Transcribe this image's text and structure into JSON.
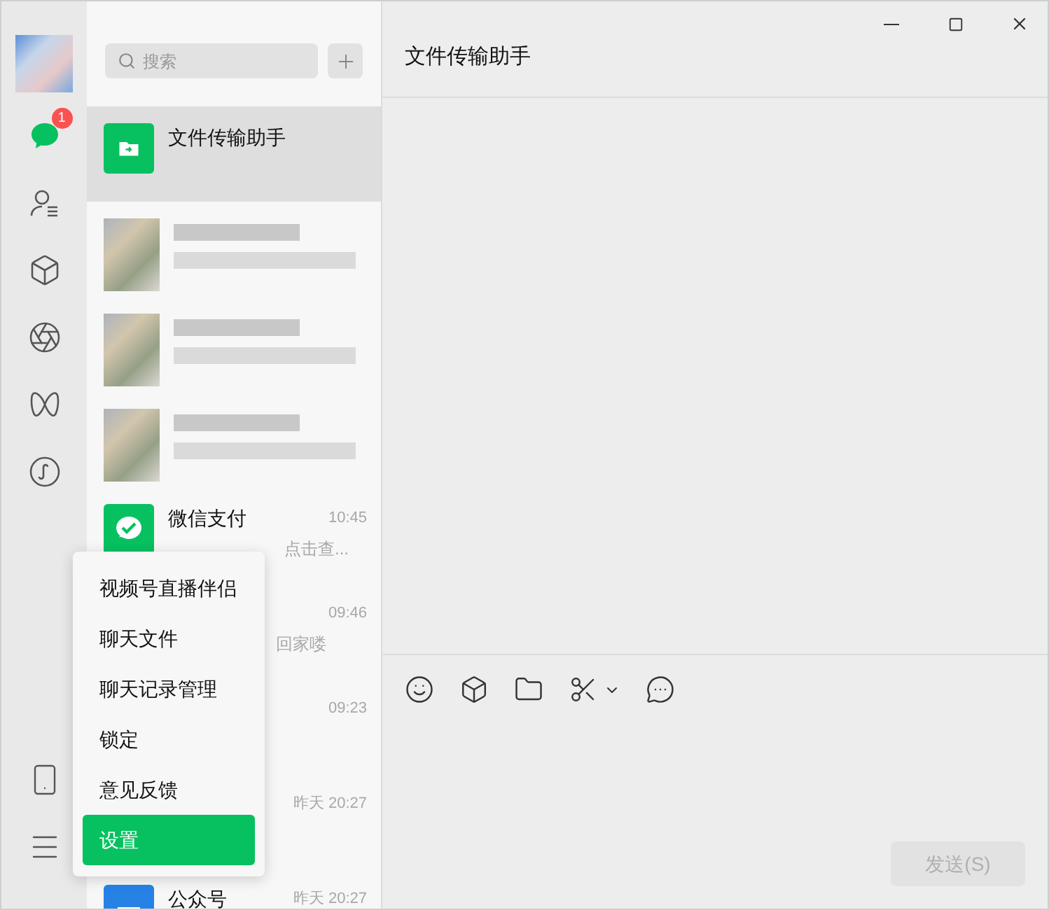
{
  "window": {
    "title": "文件传输助手"
  },
  "sidebar": {
    "items": [
      {
        "kind": "chat",
        "selected": true,
        "badge": "1"
      },
      {
        "kind": "contacts",
        "selected": false
      },
      {
        "kind": "cube",
        "selected": false
      },
      {
        "kind": "shutter",
        "selected": false
      },
      {
        "kind": "channels",
        "selected": false
      },
      {
        "kind": "miniprogram",
        "selected": false
      }
    ],
    "bottom_items": [
      {
        "kind": "phone"
      },
      {
        "kind": "menu"
      }
    ]
  },
  "search": {
    "placeholder": "搜索"
  },
  "chats": [
    {
      "kind": "file",
      "name": "文件传输助手",
      "selected": true
    },
    {
      "kind": "blurred",
      "selected": false
    },
    {
      "kind": "blurred",
      "selected": false
    },
    {
      "kind": "blurred",
      "selected": false
    },
    {
      "kind": "pay",
      "name": "微信支付",
      "time": "10:45",
      "preview": "点击查...",
      "selected": false
    },
    {
      "kind": "covered",
      "time": "09:46",
      "preview": "回家喽",
      "selected": false
    },
    {
      "kind": "covered",
      "time": "09:23",
      "selected": false
    },
    {
      "kind": "covered",
      "time": "昨天 20:27",
      "selected": false
    },
    {
      "kind": "official",
      "name": "公众号",
      "time": "昨天 20:27",
      "selected": false
    }
  ],
  "menu": [
    {
      "label": "视频号直播伴侣",
      "selected": false
    },
    {
      "label": "聊天文件",
      "selected": false
    },
    {
      "label": "聊天记录管理",
      "selected": false
    },
    {
      "label": "锁定",
      "selected": false
    },
    {
      "label": "意见反馈",
      "selected": false
    },
    {
      "label": "设置",
      "selected": true
    }
  ],
  "send_button": {
    "label": "发送(S)",
    "disabled": true
  }
}
